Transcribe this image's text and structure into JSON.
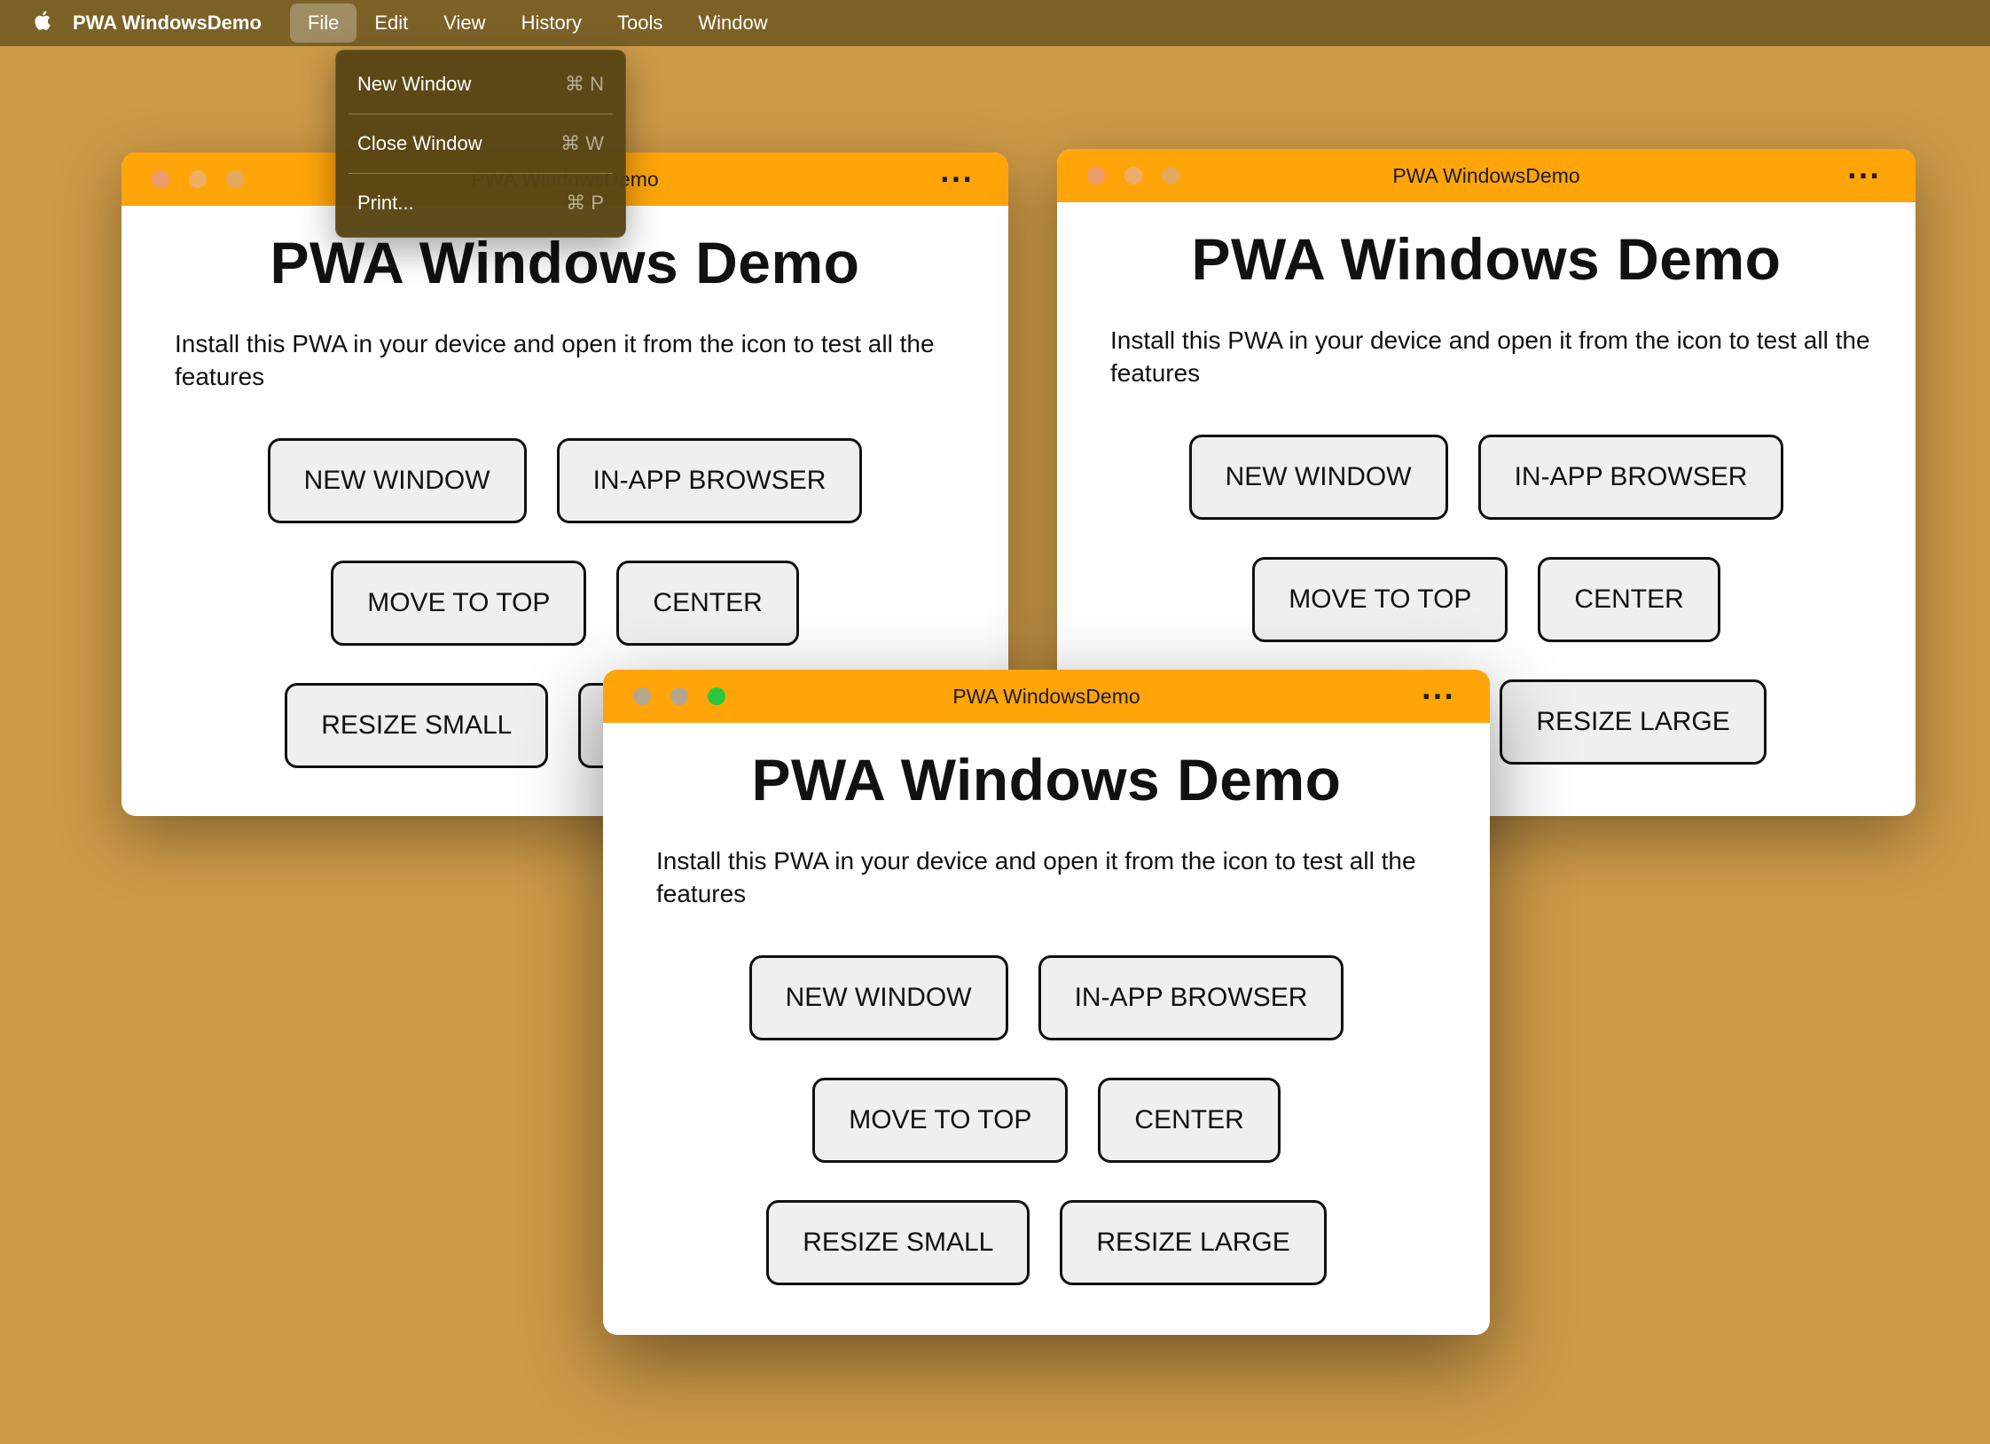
{
  "menubar": {
    "app_name": "PWA WindowsDemo",
    "menus": [
      "File",
      "Edit",
      "View",
      "History",
      "Tools",
      "Window"
    ]
  },
  "file_menu": {
    "items": [
      {
        "label": "New Window",
        "shortcut": "⌘ N"
      },
      {
        "label": "Close Window",
        "shortcut": "⌘ W"
      },
      {
        "label": "Print...",
        "shortcut": "⌘ P"
      }
    ]
  },
  "window_content": {
    "title": "PWA WindowsDemo",
    "heading": "PWA Windows Demo",
    "description": "Install this PWA in your device and open it from the icon to test all the features",
    "buttons": [
      "NEW WINDOW",
      "IN-APP BROWSER",
      "MOVE TO TOP",
      "CENTER",
      "RESIZE SMALL",
      "RESIZE LARGE"
    ]
  },
  "icons": {
    "ellipsis": "⋯"
  },
  "colors": {
    "desktop": "#cd9a48",
    "menubar_bg": "#7c6127",
    "titlebar_orange": "#ffa50a",
    "button_bg": "#efefef",
    "active_light_green": "#28c73f"
  }
}
